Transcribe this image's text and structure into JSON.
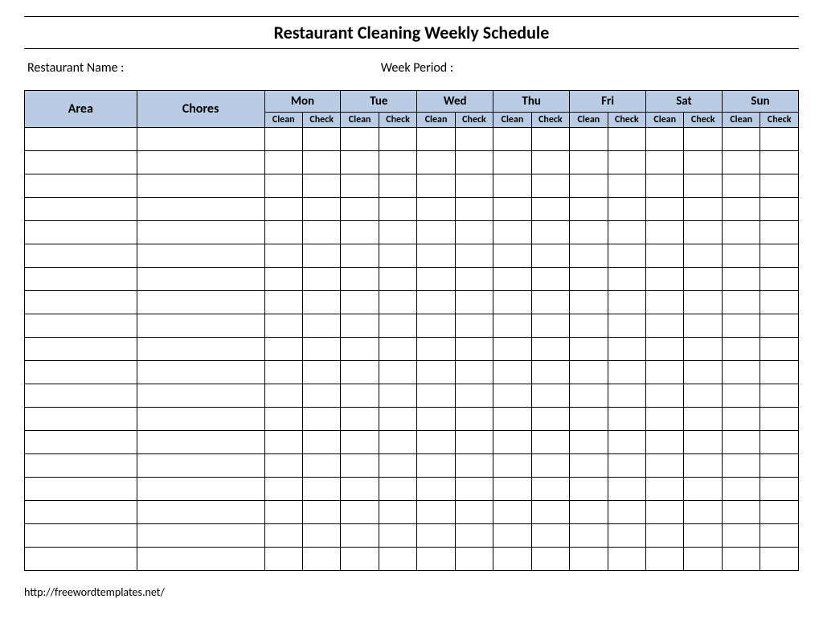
{
  "title": "Restaurant Cleaning Weekly Schedule",
  "meta": {
    "restaurant_label": "Restaurant Name   :",
    "week_label": "Week  Period :"
  },
  "headers": {
    "area": "Area",
    "chores": "Chores",
    "days": [
      "Mon",
      "Tue",
      "Wed",
      "Thu",
      "Fri",
      "Sat",
      "Sun"
    ],
    "sub": {
      "clean": "Clean",
      "check": "Check"
    }
  },
  "row_count": 19,
  "footer": "http://freewordtemplates.net/"
}
